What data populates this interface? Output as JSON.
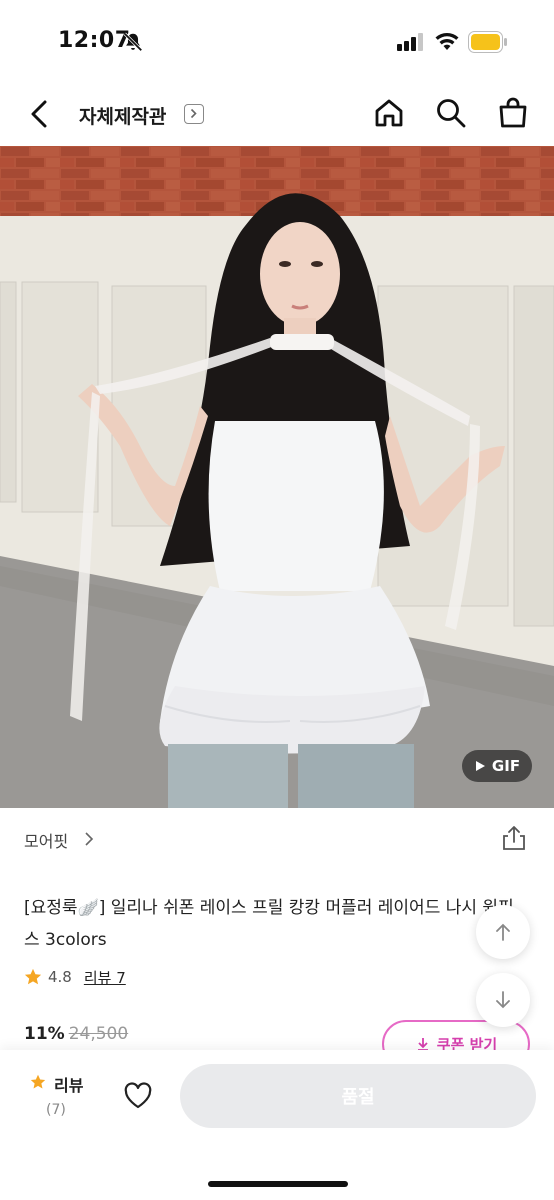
{
  "status_bar": {
    "time": "12:07"
  },
  "header": {
    "store_name": "자체제작관"
  },
  "hero": {
    "gif_badge": "GIF"
  },
  "product": {
    "brand": "모어핏",
    "title": "[요정룩🪽] 일리나 쉬폰 레이스 프릴 캉캉 머플러 레이어드 나시 원피스 3colors",
    "rating": "4.8",
    "review_link": "리뷰 7",
    "discount": "11%",
    "original_price": "24,500",
    "coupon_label": "쿠폰 받기"
  },
  "bottom_bar": {
    "review_label": "리뷰",
    "review_count": "(7)",
    "soldout_label": "품절"
  },
  "colors": {
    "accent_pink": "#e66ac6",
    "star": "#f5a623"
  },
  "icons": [
    "bell-off-icon",
    "signal-icon",
    "wifi-icon",
    "battery-icon",
    "back-icon",
    "home-icon",
    "search-icon",
    "cart-icon",
    "chevron-right-icon",
    "share-icon",
    "star-icon",
    "arrow-up-icon",
    "arrow-down-icon",
    "heart-icon",
    "download-icon",
    "play-icon"
  ]
}
